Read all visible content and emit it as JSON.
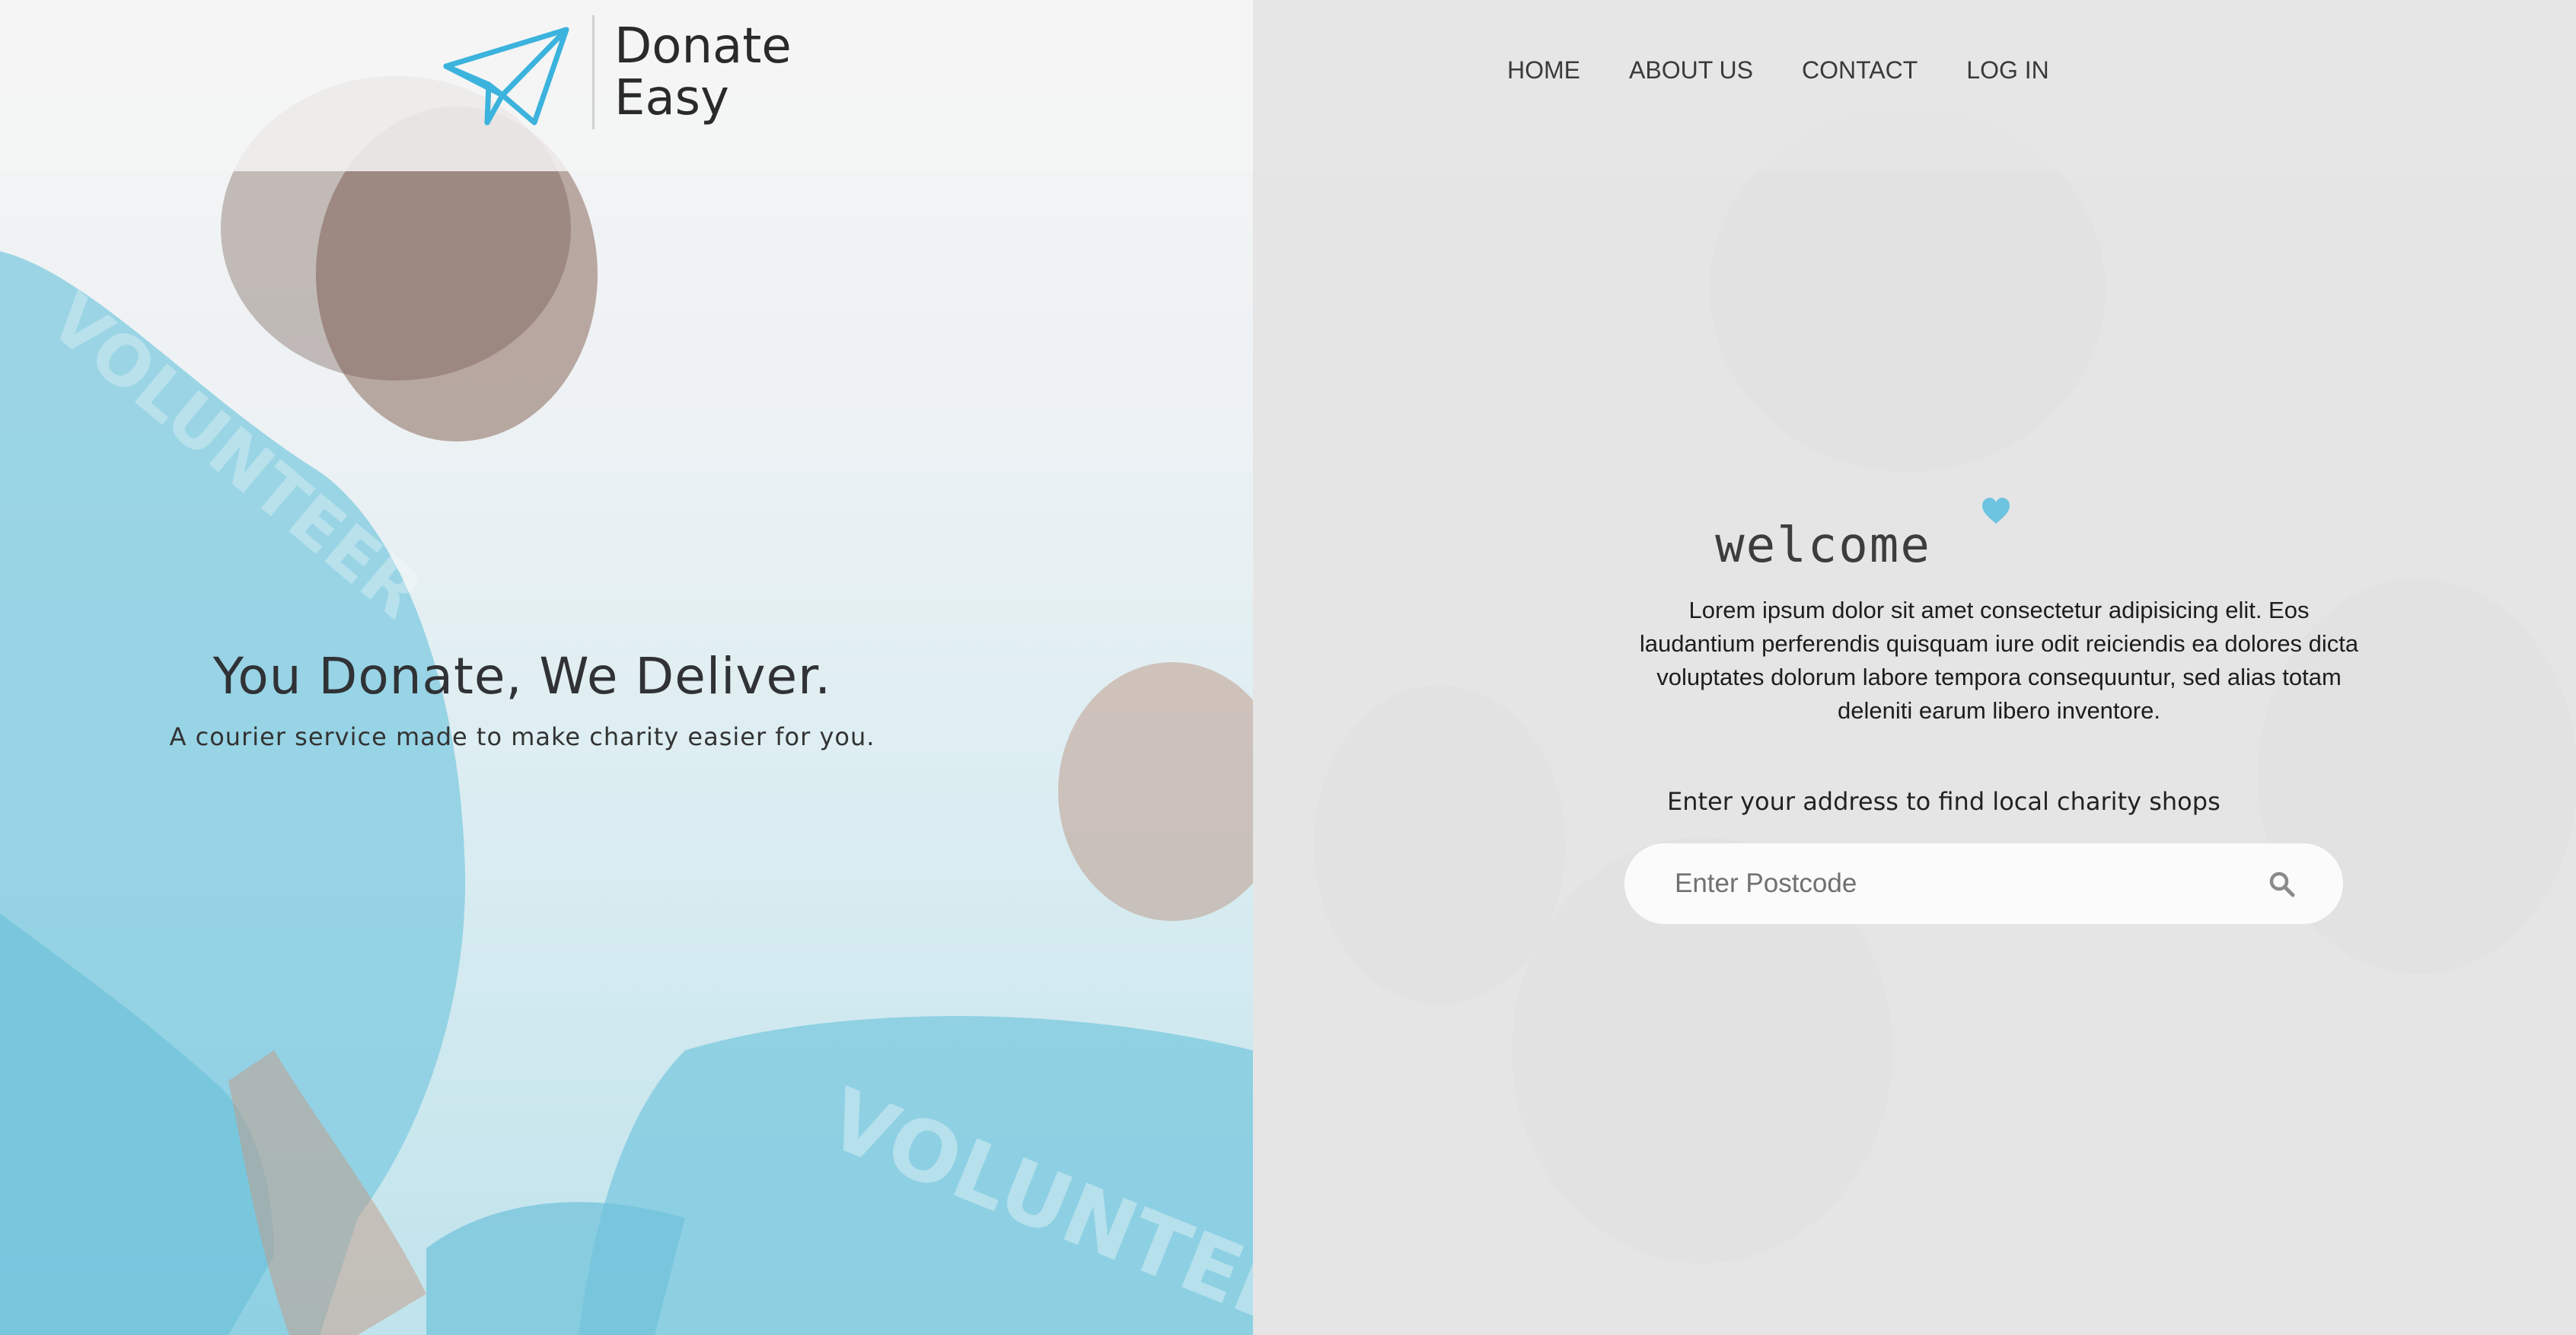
{
  "brand": {
    "line1": "Donate",
    "line2": "Easy",
    "logo_icon": "paper-plane-icon",
    "accent": "#3bb3dd"
  },
  "nav": {
    "items": [
      "HOME",
      "ABOUT US",
      "CONTACT",
      "LOG IN"
    ]
  },
  "hero": {
    "title": "You Donate, We Deliver.",
    "subtitle": "A courier service made to make charity easier for you.",
    "background_image": "volunteers-in-blue-shirts-photo"
  },
  "welcome": {
    "icon": "heart-icon",
    "heading": "welcome",
    "body": "Lorem ipsum dolor sit amet consectetur adipisicing elit. Eos laudantium perferendis quisquam iure odit reiciendis ea dolores dicta voluptates dolorum labore tempora consequuntur, sed alias totam deleniti earum libero inventore."
  },
  "search": {
    "label": "Enter your address to find local charity shops",
    "placeholder": "Enter Postcode",
    "icon": "search-icon"
  },
  "colors": {
    "heart": "#6cc4e0",
    "left_panel_tint": "#bfe3ec",
    "right_panel": "#e5e5e6"
  }
}
